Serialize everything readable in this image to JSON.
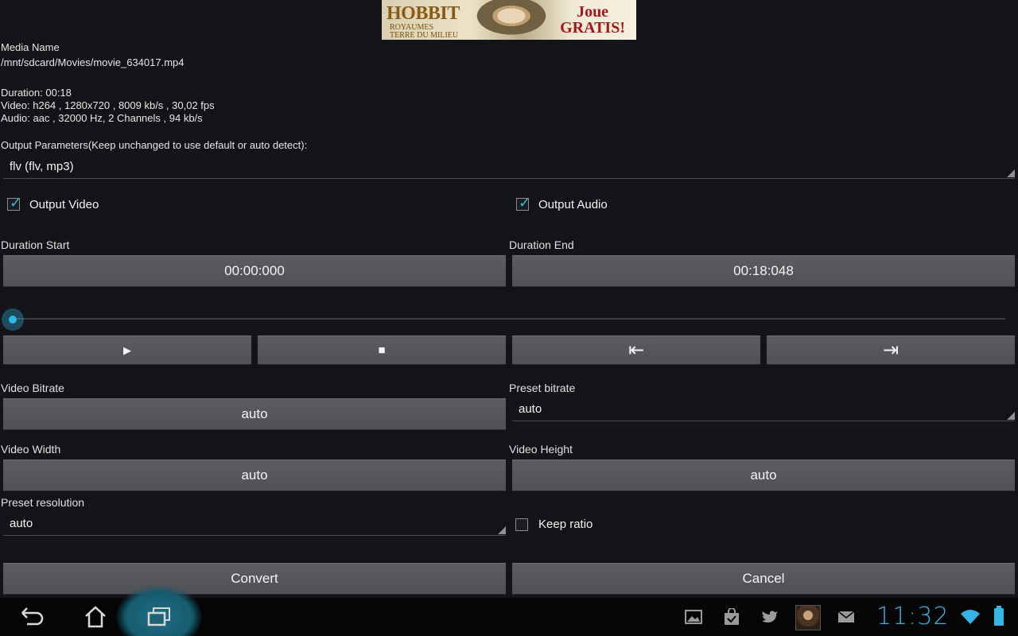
{
  "ad": {
    "title": "HOBBIT",
    "subtitle_line1": "ROYAUMES",
    "subtitle_line2": "TERRE DU MILIEU",
    "cta_line1": "Joue",
    "cta_line2": "GRATIS!"
  },
  "media": {
    "name_label": "Media Name",
    "path": "/mnt/sdcard/Movies/movie_634017.mp4",
    "duration": "Duration: 00:18",
    "video": "Video: h264 , 1280x720 , 8009 kb/s , 30,02 fps",
    "audio": "Audio: aac , 32000 Hz, 2 Channels , 94 kb/s"
  },
  "output": {
    "params_label": "Output Parameters(Keep unchanged to use default or auto detect):",
    "format_value": "flv (flv, mp3)",
    "output_video_label": "Output Video",
    "output_video_checked": true,
    "output_audio_label": "Output Audio",
    "output_audio_checked": true
  },
  "duration": {
    "start_label": "Duration Start",
    "start_value": "00:00:000",
    "end_label": "Duration End",
    "end_value": "00:18:048",
    "seek_fraction": 0.0
  },
  "playback": {
    "play_icon": "▶",
    "stop_icon": "■",
    "set_start_icon": "⇤",
    "set_end_icon": "⇥"
  },
  "bitrate": {
    "video_bitrate_label": "Video Bitrate",
    "video_bitrate_value": "auto",
    "preset_bitrate_label": "Preset bitrate",
    "preset_bitrate_value": "auto"
  },
  "size": {
    "width_label": "Video Width",
    "width_value": "auto",
    "height_label": "Video Height",
    "height_value": "auto",
    "preset_resolution_label": "Preset resolution",
    "preset_resolution_value": "auto",
    "keep_ratio_label": "Keep ratio",
    "keep_ratio_checked": false
  },
  "actions": {
    "convert_label": "Convert",
    "cancel_label": "Cancel"
  },
  "statusbar": {
    "clock": "11:32",
    "accent_color": "#33b5e5"
  }
}
